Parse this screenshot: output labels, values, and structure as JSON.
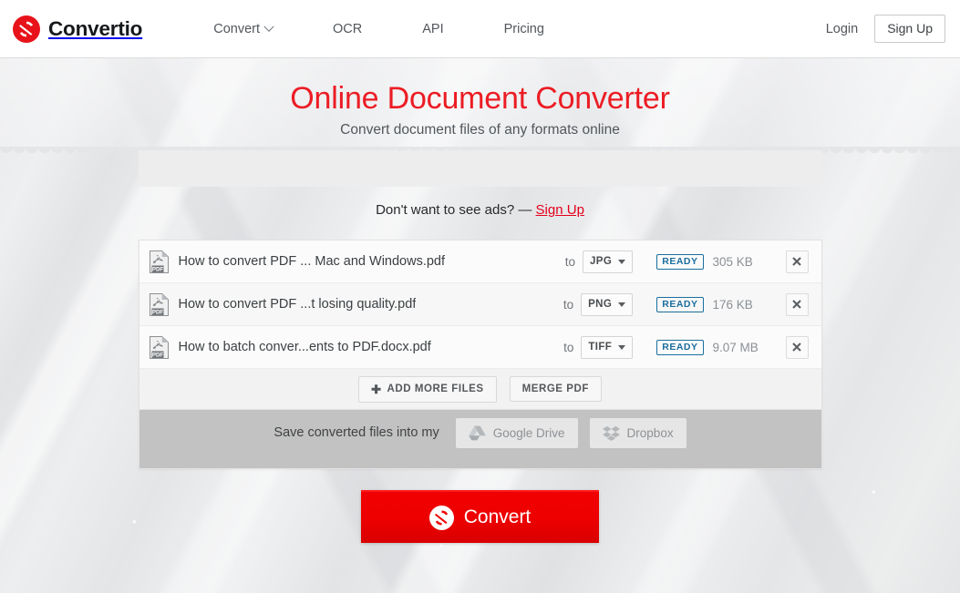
{
  "header": {
    "brand": "Convertio",
    "brand_logo_icon": "convertio-refresh-logo-icon",
    "nav": [
      {
        "label": "Convert",
        "has_caret": true
      },
      {
        "label": "OCR",
        "has_caret": false
      },
      {
        "label": "API",
        "has_caret": false
      },
      {
        "label": "Pricing",
        "has_caret": false
      }
    ],
    "login_label": "Login",
    "signup_label": "Sign Up"
  },
  "hero": {
    "title": "Online Document Converter",
    "subtitle": "Convert document files of any formats online",
    "title_color": "#ec1c24"
  },
  "ads": {
    "note_text": "Don't want to see ads? — ",
    "note_link": "Sign Up",
    "link_color": "#e4001b"
  },
  "files": {
    "to_label": "to",
    "rows": [
      {
        "icon": "pdf-file-icon",
        "name": "How to convert PDF ... Mac and Windows.pdf",
        "format": "JPG",
        "status": "READY",
        "size": "305 KB",
        "remove_icon": "close-icon"
      },
      {
        "icon": "pdf-file-icon",
        "name": "How to convert PDF ...t losing quality.pdf",
        "format": "PNG",
        "status": "READY",
        "size": "176 KB",
        "remove_icon": "close-icon"
      },
      {
        "icon": "pdf-file-icon",
        "name": "How to batch conver...ents to PDF.docx.pdf",
        "format": "TIFF",
        "status": "READY",
        "size": "9.07 MB",
        "remove_icon": "close-icon"
      }
    ],
    "status_color": "#1b6e9e"
  },
  "actions": {
    "add_more_label": "ADD MORE FILES",
    "add_more_icon": "plus-icon",
    "merge_label": "MERGE PDF"
  },
  "cloud": {
    "label": "Save converted files into my",
    "google_drive_label": "Google Drive",
    "google_drive_icon": "google-drive-icon",
    "dropbox_label": "Dropbox",
    "dropbox_icon": "dropbox-icon"
  },
  "convert": {
    "label": "Convert",
    "icon": "convertio-refresh-logo-icon",
    "color": "#ef0000"
  }
}
